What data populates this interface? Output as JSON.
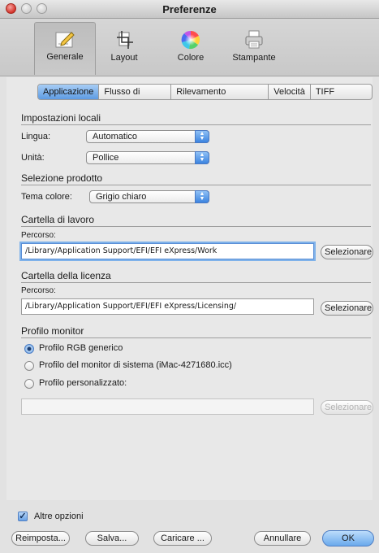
{
  "window": {
    "title": "Preferenze"
  },
  "toolbar": {
    "items": [
      {
        "label": "Generale",
        "icon": "general-pen-icon"
      },
      {
        "label": "Layout",
        "icon": "layout-crop-icon"
      },
      {
        "label": "Colore",
        "icon": "color-wheel-icon"
      },
      {
        "label": "Stampante",
        "icon": "printer-icon"
      }
    ]
  },
  "subtabs": [
    "Applicazione",
    "Flusso di lavoro",
    "Rilevamento processo",
    "Velocità",
    "TIFF Esporta"
  ],
  "locale": {
    "heading": "Impostazioni locali",
    "language_label": "Lingua:",
    "language_value": "Automatico",
    "units_label": "Unità:",
    "units_value": "Pollice"
  },
  "product": {
    "heading": "Selezione prodotto",
    "theme_label": "Tema colore:",
    "theme_value": "Grigio chiaro"
  },
  "workdir": {
    "heading": "Cartella di lavoro",
    "path_label": "Percorso:",
    "path_value": "/Library/Application Support/EFI/EFI eXpress/Work",
    "select_button": "Selezionare"
  },
  "license": {
    "heading": "Cartella della licenza",
    "path_label": "Percorso:",
    "path_value": "/Library/Application Support/EFI/EFI eXpress/Licensing/",
    "select_button": "Selezionare"
  },
  "monitor": {
    "heading": "Profilo monitor",
    "options": [
      {
        "label": "Profilo RGB generico",
        "selected": true
      },
      {
        "label": "Profilo del monitor di sistema (iMac-4271680.icc)",
        "selected": false
      },
      {
        "label": "Profilo personalizzato:",
        "selected": false
      }
    ],
    "custom_path": "",
    "select_button": "Selezionare"
  },
  "footer": {
    "more_options": "Altre opzioni",
    "more_options_checked": true,
    "reset": "Reimposta...",
    "save": "Salva...",
    "load": "Caricare ...",
    "cancel": "Annullare",
    "ok": "OK"
  },
  "colors": {
    "accent": "#6aa9ec",
    "window_bg": "#e2e2e2"
  }
}
